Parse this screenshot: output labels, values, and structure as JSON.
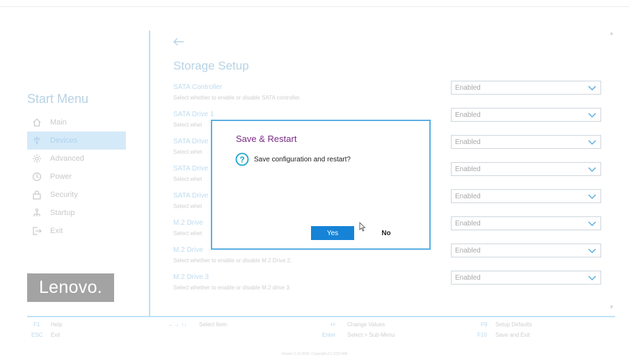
{
  "sidebar": {
    "title": "Start Menu",
    "items": [
      {
        "label": "Main",
        "icon": "home-icon"
      },
      {
        "label": "Devices",
        "icon": "devices-icon"
      },
      {
        "label": "Advanced",
        "icon": "gear-icon"
      },
      {
        "label": "Power",
        "icon": "power-icon"
      },
      {
        "label": "Security",
        "icon": "lock-icon"
      },
      {
        "label": "Startup",
        "icon": "startup-icon"
      },
      {
        "label": "Exit",
        "icon": "exit-icon"
      }
    ],
    "active_item": "Devices",
    "logo": "Lenovo."
  },
  "main": {
    "title": "Storage Setup",
    "settings": [
      {
        "name": "SATA Controller",
        "desc": "Select whether to enable or disable SATA controller.",
        "value": "Enabled"
      },
      {
        "name": "SATA Drive 1",
        "desc": "Select whet",
        "value": "Enabled"
      },
      {
        "name": "SATA Drive",
        "desc": "Select whet",
        "value": "Enabled"
      },
      {
        "name": "SATA Drive",
        "desc": "Select whet",
        "value": "Enabled"
      },
      {
        "name": "SATA Drive",
        "desc": "Select whet",
        "value": "Enabled"
      },
      {
        "name": "M.2 Drive",
        "desc": "Select whet",
        "value": "Enabled"
      },
      {
        "name": "M.2 Drive",
        "desc": "Select whether to enable or disable M.2 Drive 2.",
        "value": "Enabled"
      },
      {
        "name": "M.2 Drive 3",
        "desc": "Select whether to enable or disable M.2 drive 3.",
        "value": "Enabled"
      }
    ]
  },
  "dialog": {
    "title": "Save & Restart",
    "message": "Save configuration and restart?",
    "yes_label": "Yes",
    "no_label": "No"
  },
  "footer": {
    "items": [
      {
        "key": "F1",
        "label": "Help"
      },
      {
        "key": "ESC",
        "label": "Exit"
      },
      {
        "key": "←→ ↑↓",
        "label": "Select Item"
      },
      {
        "key": "+/-",
        "label": "Change Values"
      },
      {
        "key": "Enter",
        "label": "Select > Sub-Menu"
      },
      {
        "key": "F9",
        "label": "Setup Defaults"
      },
      {
        "key": "F10",
        "label": "Save and Exit"
      }
    ],
    "version": "Version 2.22.0000. Copyright (C) 2023 AMI"
  },
  "colors": {
    "accent": "#1683d6",
    "dialog_border": "#5aaee3",
    "dialog_title": "#7b2a86",
    "help_icon": "#1aa6c8"
  }
}
